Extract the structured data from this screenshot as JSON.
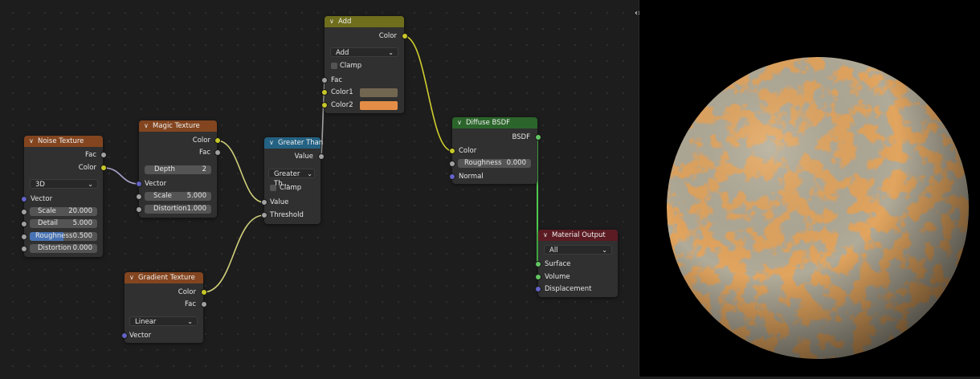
{
  "nodes": {
    "noise": {
      "title": "Noise Texture",
      "out_fac": "Fac",
      "out_color": "Color",
      "dimension": "3D",
      "in_vector": "Vector",
      "scale_label": "Scale",
      "scale_value": "20.000",
      "detail_label": "Detail",
      "detail_value": "5.000",
      "roughness_label": "Roughness",
      "roughness_value": "0.500",
      "roughness_fraction": 0.5,
      "distortion_label": "Distortion",
      "distortion_value": "0.000"
    },
    "magic": {
      "title": "Magic Texture",
      "out_color": "Color",
      "out_fac": "Fac",
      "depth_label": "Depth",
      "depth_value": "2",
      "in_vector": "Vector",
      "scale_label": "Scale",
      "scale_value": "5.000",
      "distortion_label": "Distortion",
      "distortion_value": "1.000"
    },
    "gradient": {
      "title": "Gradient Texture",
      "out_color": "Color",
      "out_fac": "Fac",
      "type": "Linear",
      "in_vector": "Vector"
    },
    "greater": {
      "title": "Greater Than",
      "out_value": "Value",
      "operation": "Greater Th...",
      "clamp": "Clamp",
      "in_value": "Value",
      "in_threshold": "Threshold"
    },
    "add": {
      "title": "Add",
      "out_color": "Color",
      "blend_mode": "Add",
      "clamp": "Clamp",
      "in_fac": "Fac",
      "in_color1": "Color1",
      "color1": "#716650",
      "in_color2": "Color2",
      "color2": "#e48d47"
    },
    "diffuse": {
      "title": "Diffuse BSDF",
      "out_bsdf": "BSDF",
      "in_color": "Color",
      "roughness_label": "Roughness",
      "roughness_value": "0.000",
      "in_normal": "Normal"
    },
    "output": {
      "title": "Material Output",
      "target": "All",
      "in_surface": "Surface",
      "in_volume": "Volume",
      "in_displacement": "Displacement"
    }
  },
  "icons": {
    "collapse": "chevron-down-icon",
    "dropdown": "chevron-down-icon",
    "sidebar_toggle": "expand-arrows-icon"
  },
  "colors": {
    "socket_color": "#c7c729",
    "socket_float": "#a1a1a1",
    "socket_vector": "#6363c7",
    "socket_shader": "#63c763",
    "texture_header": "#83451f",
    "converter_header": "#246283",
    "color_header": "#6e6e1d",
    "shader_header": "#2b652b",
    "output_header": "#5c1b23"
  },
  "preview": {
    "sphere_base": "#e2a55f",
    "sphere_pattern": "#6f6650"
  }
}
